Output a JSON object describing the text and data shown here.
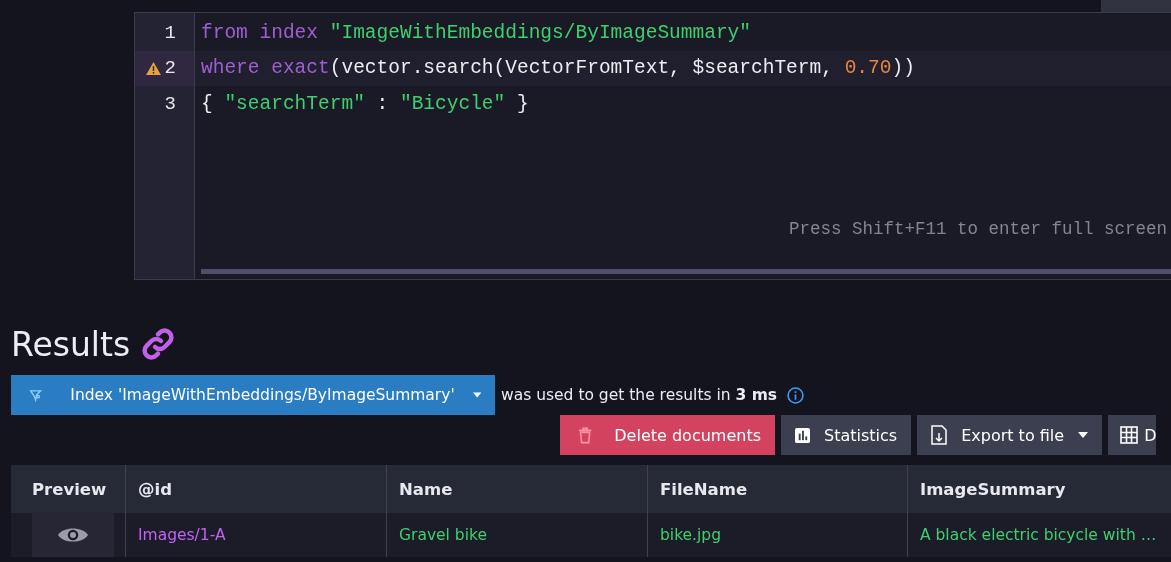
{
  "editor": {
    "lines": [
      {
        "number": "1",
        "warning": false,
        "tokens": [
          {
            "text": "from index ",
            "kind": "keyword"
          },
          {
            "text": "\"ImageWithEmbeddings/ByImageSummary\"",
            "kind": "string"
          }
        ]
      },
      {
        "number": "2",
        "warning": true,
        "tokens": [
          {
            "text": "where exact",
            "kind": "keyword"
          },
          {
            "text": "(vector.search(VectorFromText, $searchTerm, ",
            "kind": "plain"
          },
          {
            "text": "0.70",
            "kind": "number"
          },
          {
            "text": "))",
            "kind": "plain"
          }
        ]
      },
      {
        "number": "3",
        "warning": false,
        "tokens": [
          {
            "text": "{ ",
            "kind": "plain"
          },
          {
            "text": "\"searchTerm\"",
            "kind": "string"
          },
          {
            "text": " : ",
            "kind": "plain"
          },
          {
            "text": "\"Bicycle\"",
            "kind": "string"
          },
          {
            "text": " }",
            "kind": "plain"
          }
        ]
      }
    ],
    "hint": "Press Shift+F11 to enter full screen"
  },
  "results": {
    "title": "Results",
    "index_button": "Index 'ImageWithEmbeddings/ByImageSummary'",
    "info": "was used to get the results in **3 ms**"
  },
  "actions": [
    {
      "label": "Delete documents",
      "kind": "danger"
    },
    {
      "label": "Statistics",
      "kind": "stats"
    },
    {
      "label": "Export to file",
      "kind": "export"
    },
    {
      "label": "D",
      "kind": "grid"
    }
  ],
  "table": {
    "columns": [
      "Preview",
      "@id",
      "Name",
      "FileName",
      "ImageSummary"
    ],
    "rows": [
      {
        "id": "Images/1-A",
        "name": "Gravel bike",
        "file": "bike.jpg",
        "summary": "A black electric bicycle with …"
      }
    ]
  }
}
